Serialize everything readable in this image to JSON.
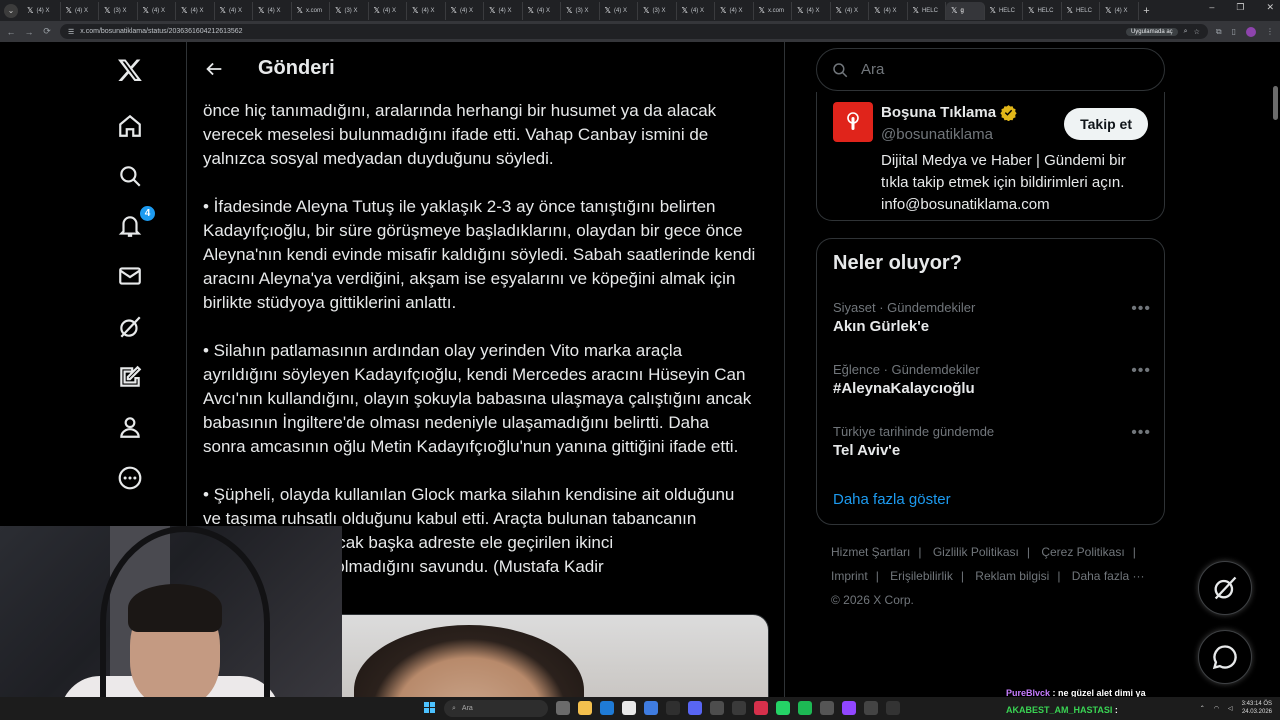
{
  "browser": {
    "tabs": [
      {
        "label": "(4) X"
      },
      {
        "label": "(4) X"
      },
      {
        "label": "(3) X"
      },
      {
        "label": "(4) X"
      },
      {
        "label": "(4) X"
      },
      {
        "label": "(4) X"
      },
      {
        "label": "(4) X"
      },
      {
        "label": "x.com"
      },
      {
        "label": "(3) X"
      },
      {
        "label": "(4) X"
      },
      {
        "label": "(4) X"
      },
      {
        "label": "(4) X"
      },
      {
        "label": "(4) X"
      },
      {
        "label": "(4) X"
      },
      {
        "label": "(3) X"
      },
      {
        "label": "(4) X"
      },
      {
        "label": "(3) X"
      },
      {
        "label": "(4) X"
      },
      {
        "label": "(4) X"
      },
      {
        "label": "x.com"
      },
      {
        "label": "(4) X"
      },
      {
        "label": "(4) X"
      },
      {
        "label": "(4) X"
      },
      {
        "label": "HELC"
      },
      {
        "label": "g"
      },
      {
        "label": "HELC"
      },
      {
        "label": "HELC"
      },
      {
        "label": "HELC"
      },
      {
        "label": "(4) X"
      }
    ],
    "active_tab_index": 24,
    "url": "x.com/bosunatiklama/status/2036361604212613562",
    "app_pill": "Uygulamada aç"
  },
  "nav": {
    "notification_count": "4"
  },
  "post": {
    "header_title": "Gönderi",
    "paragraphs": [
      "önce hiç tanımadığını, aralarında herhangi bir husumet ya da alacak\nverecek meselesi bulunmadığını ifade etti. Vahap Canbay ismini de\nyalnızca sosyal medyadan duyduğunu söyledi.",
      "• İfadesinde Aleyna Tutuş ile yaklaşık 2-3 ay önce tanıştığını belirten\nKadayıfçıoğlu, bir süre görüşmeye başladıklarını, olaydan bir gece önce\nAleyna'nın kendi evinde misafir kaldığını söyledi. Sabah saatlerinde kendi\naracını Aleyna'ya verdiğini, akşam ise eşyalarını ve köpeğini almak için\nbirlikte stüdyoya gittiklerini anlattı.",
      "• Silahın patlamasının ardından olay yerinden Vito marka araçla\nayrıldığını söyleyen Kadayıfçıoğlu, kendi Mercedes aracını Hüseyin Can\nAvcı'nın kullandığını, olayın şokuyla babasına ulaşmaya çalıştığını ancak\nbabasının İngiltere'de olması nedeniyle ulaşamadığını belirtti. Daha\nsonra amcasının oğlu Metin Kadayıfçıoğlu'nun yanına gittiğini ifade etti.",
      "• Şüpheli, olayda kullanılan Glock marka silahın kendisine ait olduğunu\nve taşıma ruhsatlı olduğunu kabul etti. Araçta bulunan tabancanın\n                                    uğunu söyledi. Ancak başka adreste ele geçirilen ikinci\n                                    erin kendisine ait olmadığını savundu. (Mustafa Kadir"
    ]
  },
  "search": {
    "placeholder": "Ara"
  },
  "profile_card": {
    "name": "Boşuna Tıklama",
    "handle": "@bosunatiklama",
    "follow_label": "Takip et",
    "bio": "Dijital Medya ve Haber | Gündemi bir tıkla takip etmek için bildirimleri açın. info@bosunatiklama.com"
  },
  "trends": {
    "title": "Neler oluyor?",
    "items": [
      {
        "category": "Siyaset · Gündemdekiler",
        "name": "Akın Gürlek'e"
      },
      {
        "category": "Eğlence · Gündemdekiler",
        "name": "#AleynaKalaycıoğlu"
      },
      {
        "category": "Türkiye tarihinde gündemde",
        "name": "Tel Aviv'e"
      }
    ],
    "show_more": "Daha fazla göster"
  },
  "footer": {
    "links": [
      "Hizmet Şartları",
      "Gizlilik Politikası",
      "Çerez Politikası",
      "Imprint",
      "Erişilebilirlik",
      "Reklam bilgisi",
      "Daha fazla ···"
    ],
    "copyright": "© 2026 X Corp."
  },
  "chat": {
    "line1_user": "PureBlvck",
    "line1_text": ": ne güzel alet dimi ya",
    "line2_user": "AKABEST_AM_HASTASI",
    "line2_text": ":"
  },
  "taskbar": {
    "search_placeholder": "Ara",
    "time": "3:43:14 ÖS",
    "date": "24.03.2026"
  },
  "colors": {
    "accent": "#1d9bf0",
    "background": "#000000",
    "text": "#e7e9ea",
    "muted": "#71767b",
    "border": "#2f3336",
    "brand_red": "#e0241b"
  }
}
